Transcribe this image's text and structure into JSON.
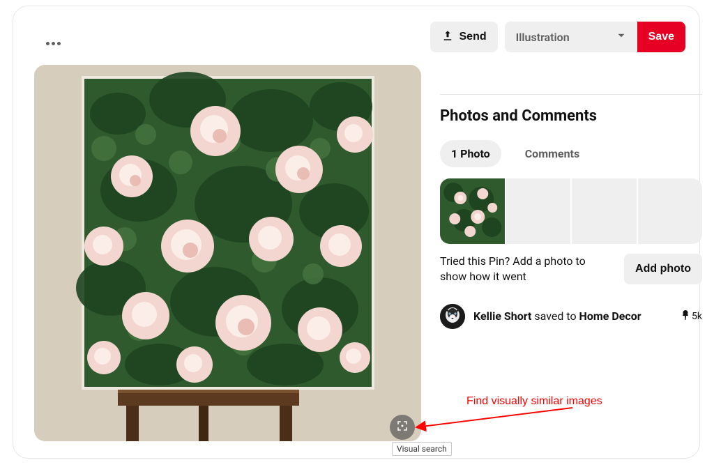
{
  "header": {
    "send_label": "Send",
    "board_selected": "Illustration",
    "save_label": "Save"
  },
  "section": {
    "title": "Photos and Comments",
    "tabs": {
      "photos": "1 Photo",
      "comments": "Comments"
    },
    "prompt_text": "Tried this Pin? Add a photo to show how it went",
    "add_photo_label": "Add photo"
  },
  "saver": {
    "name": "Kellie Short",
    "verb": " saved to ",
    "board": "Home Decor",
    "count": "5k"
  },
  "tooltip": {
    "visual_search": "Visual search"
  },
  "annotation": {
    "text": "Find visually similar images"
  },
  "icons": {
    "more": "more-icon",
    "send": "send-icon",
    "chevron_down": "chevron-down-icon",
    "visual_search": "visual-search-icon",
    "pin": "pin-icon"
  }
}
